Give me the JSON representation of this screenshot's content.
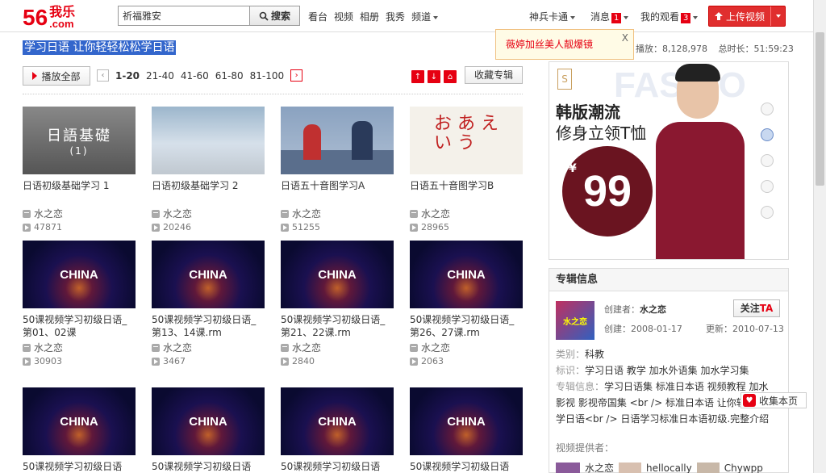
{
  "header": {
    "logo_num": "56",
    "logo_cn": "我乐",
    "logo_com": ".com",
    "search_value": "祈福雅安",
    "search_btn": "搜索",
    "nav": [
      "看台",
      "视频",
      "相册",
      "我秀",
      "频道"
    ],
    "user": "神兵卡通",
    "msg_label": "消息",
    "msg_count": "1",
    "my_watch": "我的观看",
    "watch_count": "3",
    "upload": "上传视频"
  },
  "page": {
    "title": "学习日语 让你轻轻松松学日语",
    "notice": "薇婷加丝美人靓爆镜",
    "notice_close": "X",
    "plays_label": "播放：",
    "plays": "8,128,978",
    "duration_label": "总时长：",
    "duration": "51:59:23",
    "play_all": "播放全部",
    "pages": [
      "1-20",
      "21-40",
      "41-60",
      "61-80",
      "81-100"
    ],
    "collect": "收藏专辑"
  },
  "videos": [
    {
      "title": "日语初级基础学习 1",
      "user": "水之恋",
      "views": "47871",
      "thumb_text": "日語基礎",
      "thumb_sub": "(1)"
    },
    {
      "title": "日语初级基础学习 2",
      "user": "水之恋",
      "views": "20246"
    },
    {
      "title": "日语五十音图学习A",
      "user": "水之恋",
      "views": "51255"
    },
    {
      "title": "日语五十音图学习B",
      "user": "水之恋",
      "views": "28965",
      "thumb_text": "お あ え い う"
    },
    {
      "title": "50课视频学习初级日语_第01、02课",
      "user": "水之恋",
      "views": "30903",
      "thumb_text": "CHINA"
    },
    {
      "title": "50课视频学习初级日语_第13、14课.rm",
      "user": "水之恋",
      "views": "3467",
      "thumb_text": "CHINA"
    },
    {
      "title": "50课视频学习初级日语_第21、22课.rm",
      "user": "水之恋",
      "views": "2840",
      "thumb_text": "CHINA"
    },
    {
      "title": "50课视频学习初级日语_第26、27课.rm",
      "user": "水之恋",
      "views": "2063",
      "thumb_text": "CHINA"
    },
    {
      "title": "50课视频学习初级日语",
      "thumb_text": "CHINA"
    },
    {
      "title": "50课视频学习初级日语",
      "thumb_text": "CHINA"
    },
    {
      "title": "50课视频学习初级日语",
      "thumb_text": "CHINA"
    },
    {
      "title": "50课视频学习初级日语",
      "thumb_text": "CHINA"
    }
  ],
  "ad": {
    "bg_text": "FASHIO",
    "brand": "S",
    "line1": "韩版潮流",
    "line2": "修身立领T恤",
    "yen": "¥",
    "price": "99"
  },
  "album": {
    "header": "专辑信息",
    "creator_label": "创建者：",
    "creator": "水之恋",
    "follow": "关注",
    "follow_ta": "TA",
    "created_label": "创建：",
    "created": "2008-01-17",
    "updated_label": "更新：",
    "updated": "2010-07-13",
    "category_label": "类别：",
    "category": "科教",
    "tags_label": "标识：",
    "tags": "学习日语 教学 加水外语集 加水学习集",
    "info_label": "专辑信息：",
    "info_1": "学习日语集 标准日本语 视频教程 加水",
    "info_2": "影视 影视帝国集 <br /> 标准日本语 让你轻",
    "info_3": "学日语<br /> 日语学习标准日本语初级.完整介绍",
    "providers_label": "视频提供者：",
    "providers": [
      "水之恋",
      "hellocally",
      "Chywpp"
    ],
    "cover_text": "水之恋"
  },
  "fav": "收集本页"
}
